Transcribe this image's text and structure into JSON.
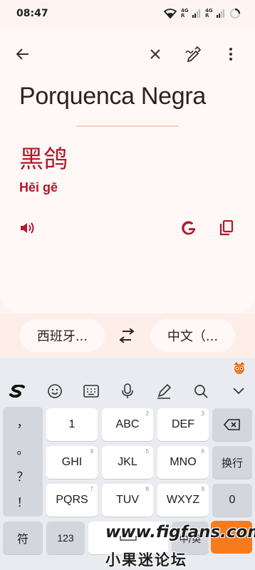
{
  "status_bar": {
    "time": "08:47",
    "net1": "4G",
    "net2": "4G",
    "r1": "R",
    "r2": "R"
  },
  "toolbar": {
    "icons": [
      "back-arrow-icon",
      "close-icon",
      "handwriting-pen-icon",
      "more-vert-icon"
    ]
  },
  "translation": {
    "source_text": "Porquenca Negra",
    "translated_text": "黑鸽",
    "romanization": "Hēi gē",
    "actions": [
      "speaker-icon",
      "google-icon",
      "copy-icon"
    ]
  },
  "languages": {
    "source": "西班牙...",
    "target": "中文（..."
  },
  "keyboard": {
    "toolbar_icons": [
      "swype-logo-icon",
      "emoji-icon",
      "keyboard-icon",
      "mic-icon",
      "handwrite-icon",
      "search-icon",
      "collapse-icon"
    ],
    "symbols": [
      "，",
      "。",
      "？",
      "！"
    ],
    "rows": [
      [
        {
          "label": "1",
          "num": ""
        },
        {
          "label": "ABC",
          "num": "2"
        },
        {
          "label": "DEF",
          "num": "3"
        }
      ],
      [
        {
          "label": "GHI",
          "num": "4"
        },
        {
          "label": "JKL",
          "num": "5"
        },
        {
          "label": "MNO",
          "num": "6"
        }
      ],
      [
        {
          "label": "PQRS",
          "num": "7"
        },
        {
          "label": "TUV",
          "num": "8"
        },
        {
          "label": "WXYZ",
          "num": "9"
        }
      ]
    ],
    "newline": "换行",
    "zero": "0",
    "symbol_key": "符",
    "num_key": "123",
    "lang_key": "中/英"
  },
  "watermark": {
    "url": "www.figfans.com",
    "name": "小果迷论坛"
  },
  "colors": {
    "accent": "#b2172b",
    "card": "#fff8f6",
    "keyboard": "#e9ebf0",
    "watermark_orange": "#f77b1d"
  }
}
